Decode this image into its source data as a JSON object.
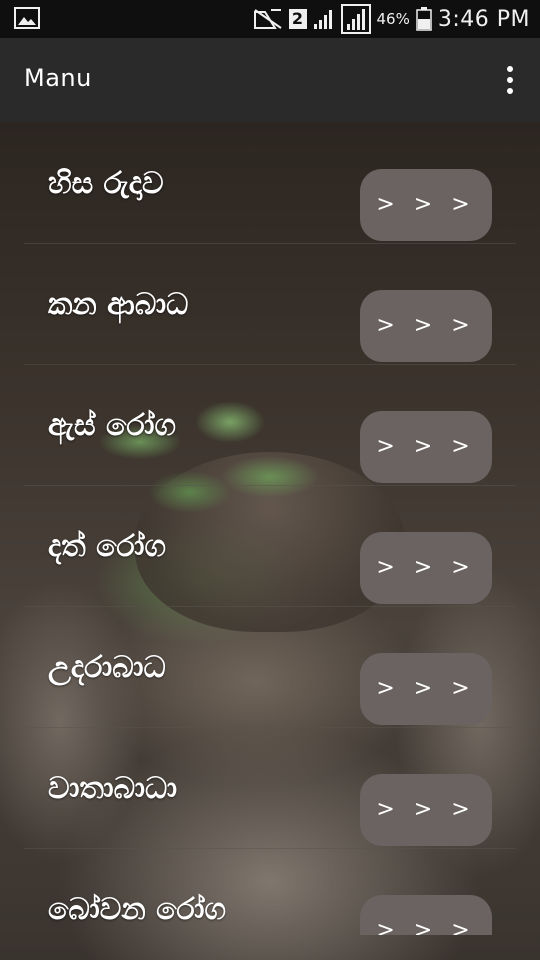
{
  "status_bar": {
    "sim": "2",
    "battery": "46%",
    "time": "3:46 PM"
  },
  "app_bar": {
    "title": "Manu"
  },
  "menu": {
    "button_label": "> > >",
    "items": [
      {
        "label": "හිස රුදාව"
      },
      {
        "label": "කන ආබාධ"
      },
      {
        "label": "ඇස් රෝග"
      },
      {
        "label": "දත් රෝග"
      },
      {
        "label": "උදරාබාධ"
      },
      {
        "label": "වාතාබාධා"
      },
      {
        "label": "බෝවන රෝග"
      }
    ]
  },
  "colors": {
    "status_bar_bg": "#0f0f0f",
    "app_bar_bg": "#2a2a2a",
    "button_bg": "#6b6361",
    "text": "#ffffff"
  }
}
